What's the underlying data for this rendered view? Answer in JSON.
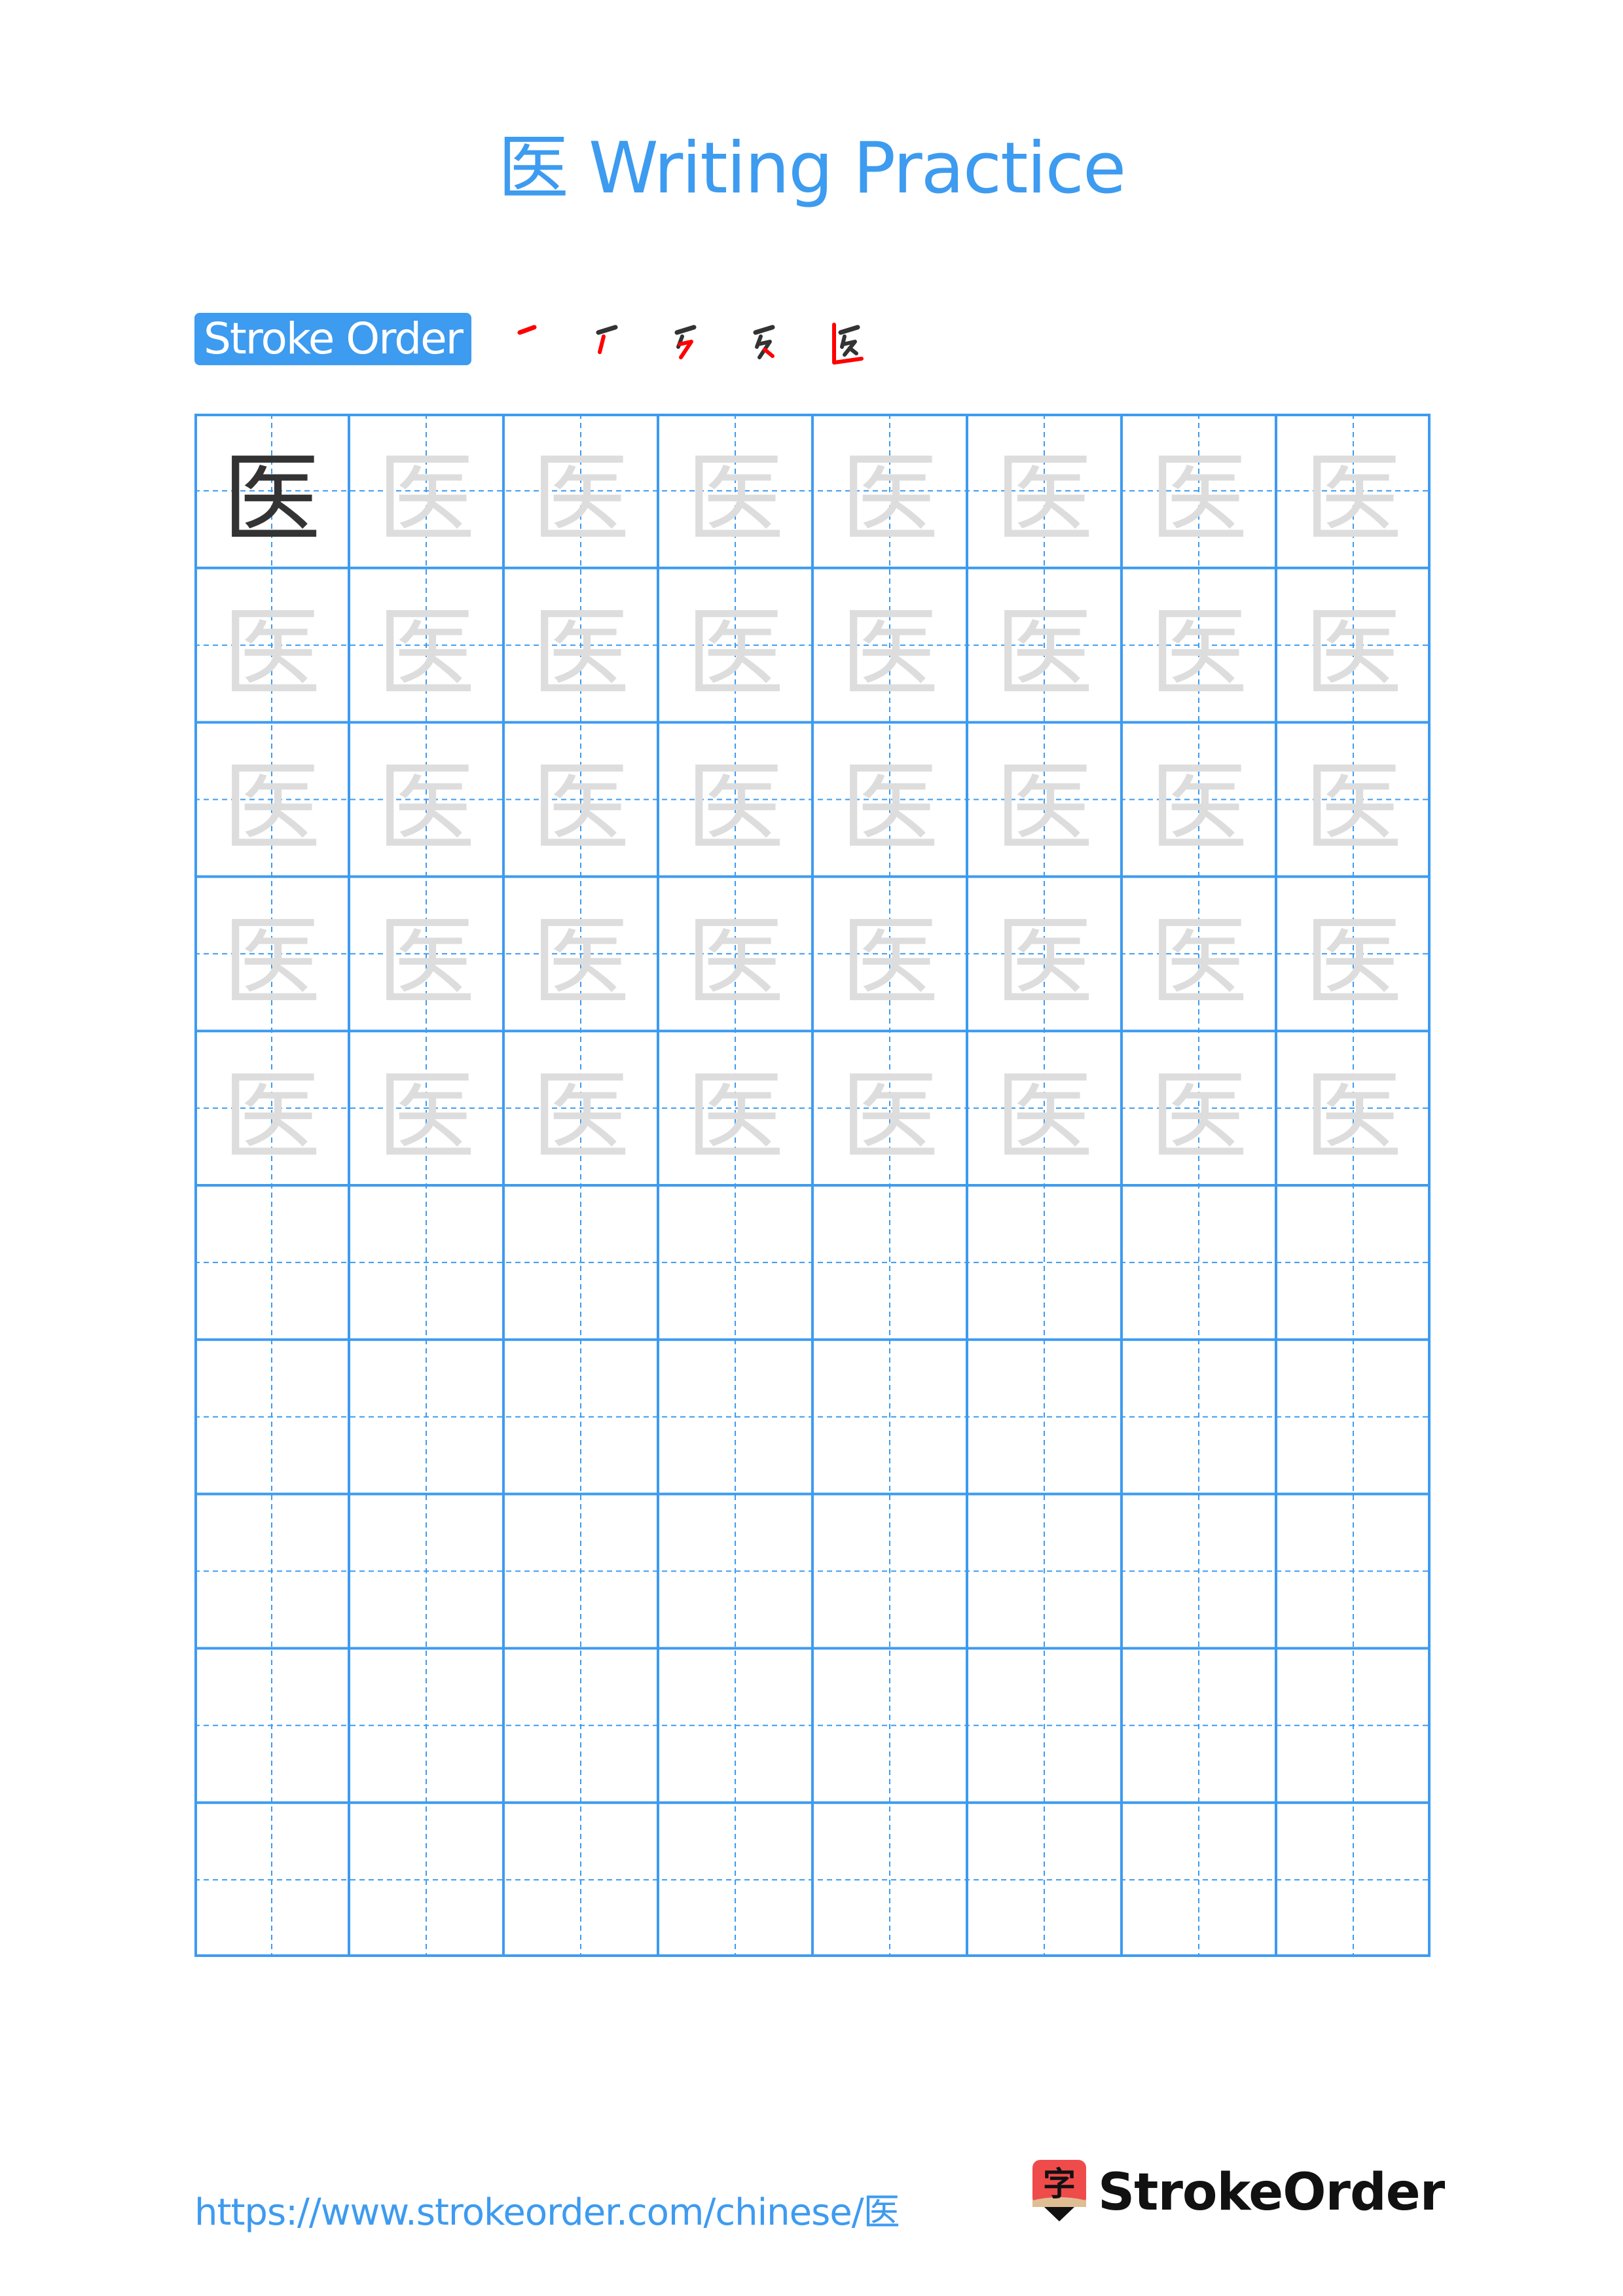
{
  "page": {
    "title": "医 Writing Practice",
    "character": "医",
    "stroke_order_label": "Stroke Order",
    "stroke_count": 5,
    "footer_url": "https://www.strokeorder.com/chinese/医",
    "brand_name": "StrokeOrder",
    "logo_glyph": "字"
  },
  "grid": {
    "columns": 8,
    "rows": 10,
    "model_rows": 5,
    "first_cell": "solid",
    "other_model_cells": "faint"
  },
  "colors": {
    "accent": "#3d9bf0",
    "model_char": "#333333",
    "trace_char": "#dddddd",
    "stroke_highlight": "#ff0000",
    "logo_red": "#ef4b4b",
    "logo_tan": "#dfbe94"
  }
}
